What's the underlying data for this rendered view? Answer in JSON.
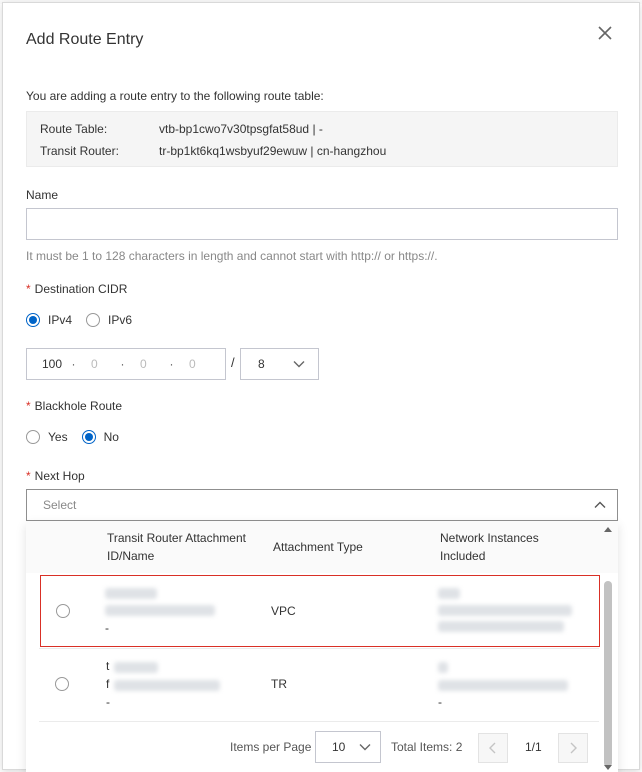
{
  "dialog": {
    "title": "Add Route Entry",
    "intro": "You are adding a route entry to the following route table:"
  },
  "info": {
    "route_table_label": "Route Table:",
    "route_table_value": "vtb-bp1cwo7v30tpsgfat58ud | -",
    "transit_router_label": "Transit Router:",
    "transit_router_value": "tr-bp1kt6kq1wsbyuf29ewuw | cn-hangzhou"
  },
  "name_field": {
    "label": "Name",
    "value": "",
    "hint": "It must be 1 to 128 characters in length and cannot start with http:// or https://."
  },
  "destination": {
    "label": "Destination CIDR",
    "options": [
      "IPv4",
      "IPv6"
    ],
    "selected": "IPv4",
    "ip_octets": [
      "100",
      "0",
      "0",
      "0"
    ],
    "slash": "/",
    "mask": "8"
  },
  "blackhole": {
    "label": "Blackhole Route",
    "options": [
      "Yes",
      "No"
    ],
    "selected": "No"
  },
  "next_hop": {
    "label": "Next Hop",
    "placeholder": "Select",
    "columns": [
      "Transit Router Attachment ID/Name",
      "Attachment Type",
      "Network Instances Included"
    ],
    "rows": [
      {
        "type": "VPC",
        "last_line": "-"
      },
      {
        "id_first_char": "t",
        "name_first_char": "f",
        "type": "TR",
        "last_line_1": "-",
        "last_line_2": "-"
      }
    ]
  },
  "pagination": {
    "items_per_page_label": "Items per Page",
    "page_size": "10",
    "total_label": "Total Items: 2",
    "page_indicator": "1/1"
  },
  "colors": {
    "primary": "#0064c8",
    "required": "#d93026",
    "highlight_border": "#d93026"
  }
}
